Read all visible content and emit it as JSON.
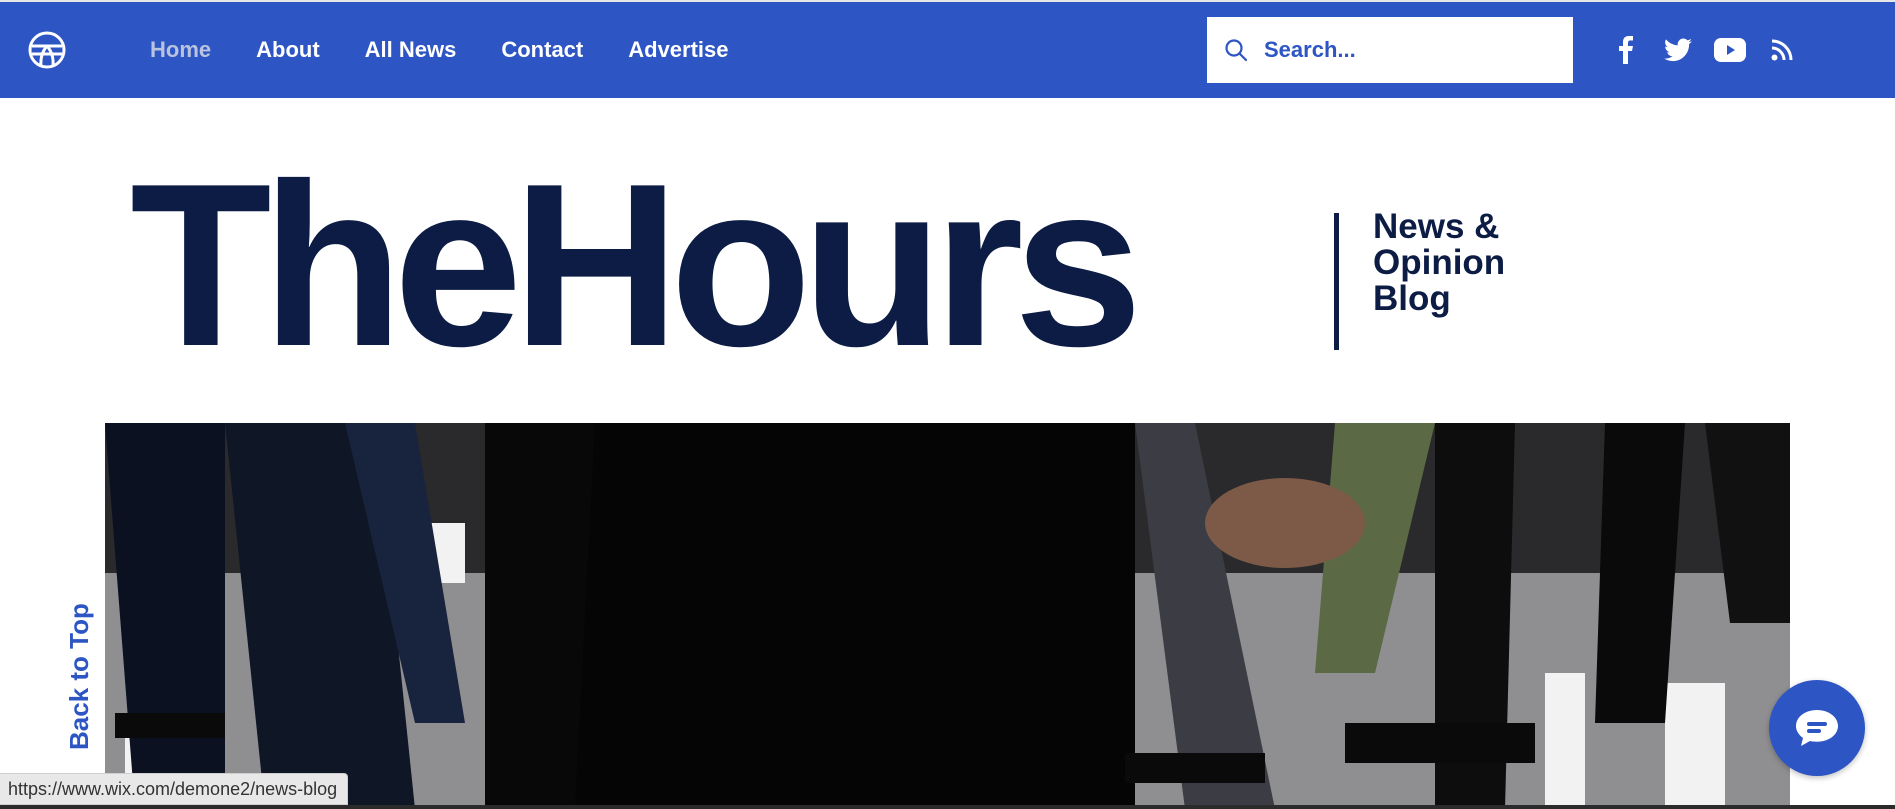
{
  "header": {
    "logo_icon": "globe-icon",
    "nav": [
      {
        "label": "Home",
        "active": true
      },
      {
        "label": "About",
        "active": false
      },
      {
        "label": "All News",
        "active": false
      },
      {
        "label": "Contact",
        "active": false
      },
      {
        "label": "Advertise",
        "active": false
      }
    ],
    "search": {
      "placeholder": "Search...",
      "value": ""
    },
    "social": [
      "facebook-icon",
      "twitter-icon",
      "youtube-icon",
      "rss-icon"
    ]
  },
  "masthead": {
    "title": "TheHours",
    "tagline": [
      "News &",
      "Opinion",
      "Blog"
    ]
  },
  "hero": {
    "description_icon": "hero-image"
  },
  "back_to_top": "Back to Top",
  "chat_icon": "chat-icon",
  "status_url": "https://www.wix.com/demone2/news-blog",
  "colors": {
    "brand": "#2d55c3",
    "navy": "#0c1c44",
    "active_nav": "#b9c3de"
  }
}
